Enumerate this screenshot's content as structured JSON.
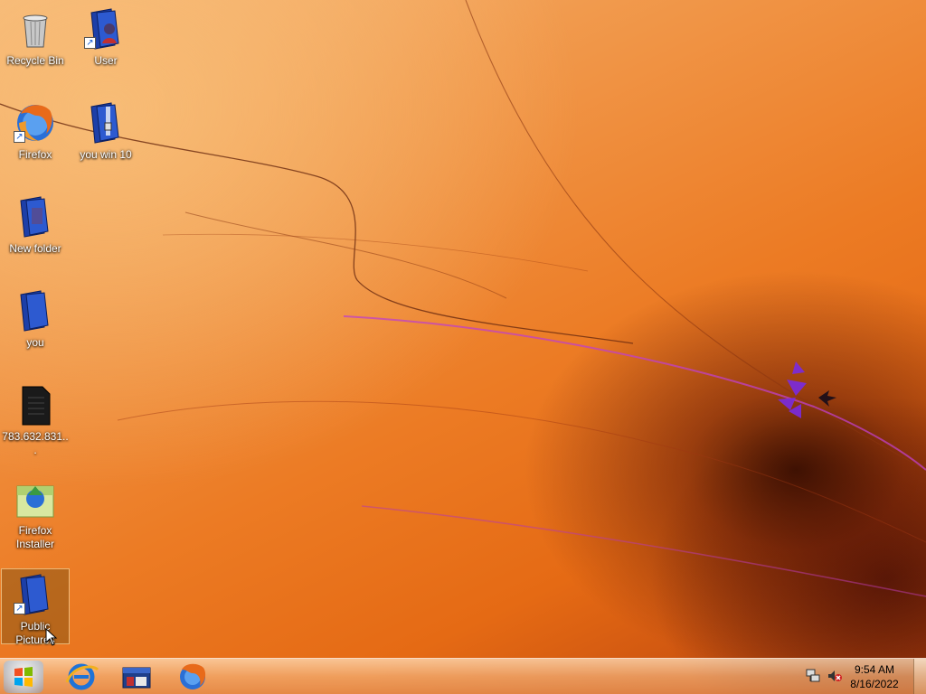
{
  "desktop": {
    "icons": [
      {
        "label": "Recycle Bin",
        "icon": "recycle-bin-icon"
      },
      {
        "label": "User",
        "icon": "user-folder-icon"
      },
      {
        "label": "Firefox",
        "icon": "firefox-icon"
      },
      {
        "label": "you win 10",
        "icon": "zip-folder-icon"
      },
      {
        "label": "New folder",
        "icon": "folder-icon"
      },
      {
        "label": "you",
        "icon": "folder-icon"
      },
      {
        "label": "783.632.831...",
        "icon": "file-icon"
      },
      {
        "label": "Firefox Installer",
        "icon": "installer-icon"
      },
      {
        "label": "Public Pictures",
        "icon": "pictures-folder-icon"
      }
    ]
  },
  "taskbar": {
    "start": {
      "icon": "windows-logo-icon"
    },
    "pinned": [
      {
        "icon": "internet-explorer-icon"
      },
      {
        "icon": "file-explorer-icon"
      },
      {
        "icon": "firefox-icon"
      }
    ],
    "tray": {
      "network_icon": "network-icon",
      "volume_icon": "volume-muted-icon",
      "time": "9:54 AM",
      "date": "8/16/2022"
    }
  },
  "colors": {
    "accent": "#ec7b24",
    "highlight": "#b040d0"
  }
}
